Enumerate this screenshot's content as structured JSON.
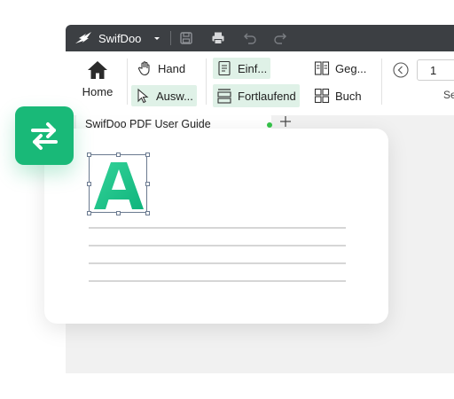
{
  "app": {
    "name": "SwifDoo"
  },
  "ribbon": {
    "home_label": "Home",
    "hand_label": "Hand",
    "select_label": "Ausw...",
    "single_label": "Einf...",
    "continuous_label": "Fortlaufend",
    "facing_label": "Geg...",
    "book_label": "Buch",
    "page_number": "1",
    "page_cut_label": "Se"
  },
  "tabs": {
    "active_title": "SwifDoo PDF User Guide"
  },
  "colors": {
    "titlebar": "#3c3f43",
    "accent": "#19b978",
    "selected_bg": "#dff1e7",
    "tab_dot": "#36c34a"
  },
  "icons": {
    "logo": "swifdoo-bird-icon",
    "dropdown": "chevron-down-icon",
    "save": "save-icon",
    "print": "print-icon",
    "undo": "undo-icon",
    "redo": "redo-icon",
    "home": "home-icon",
    "hand": "hand-icon",
    "select": "cursor-icon",
    "single": "single-page-icon",
    "continuous": "continuous-page-icon",
    "facing": "two-page-icon",
    "book": "book-icon",
    "prev": "chevron-left-icon",
    "add": "plus-icon",
    "swap": "swap-arrows-icon",
    "letter": "letter-a-icon"
  }
}
